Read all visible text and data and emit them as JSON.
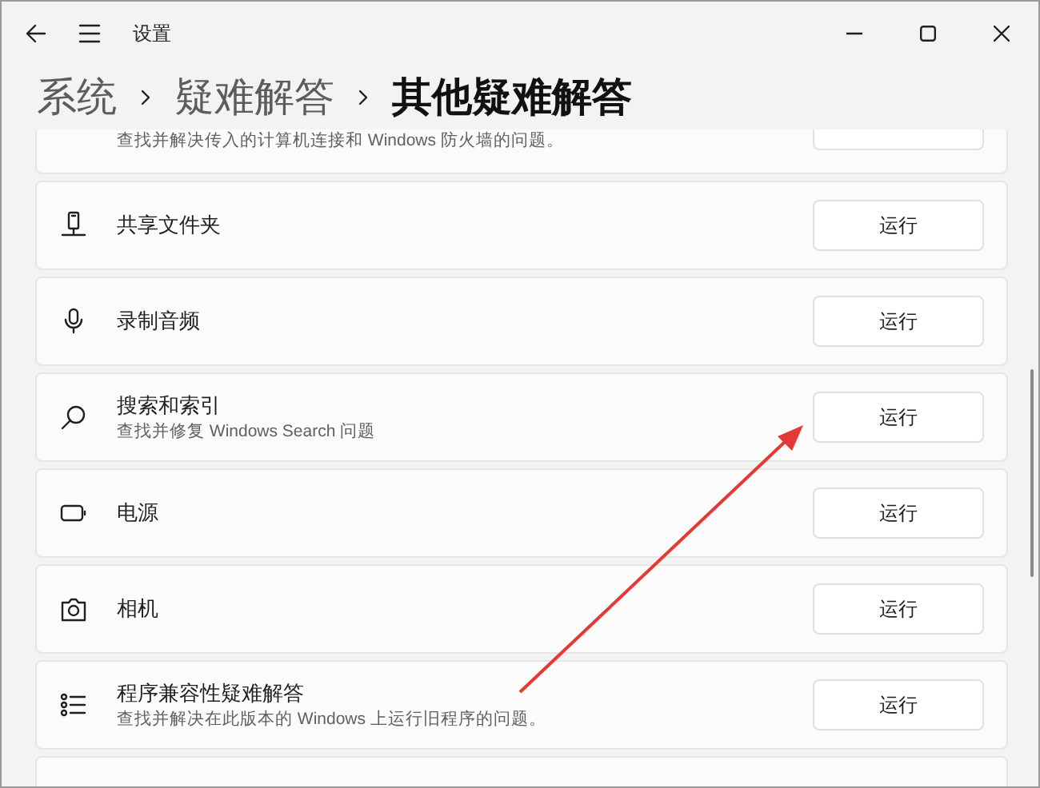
{
  "window": {
    "title": "设置"
  },
  "breadcrumb": [
    "系统",
    "疑难解答",
    "其他疑难解答"
  ],
  "items": [
    {
      "description": "查找并解决传入的计算机连接和 Windows 防火墙的问题。"
    },
    {
      "title": "共享文件夹",
      "button": "运行"
    },
    {
      "title": "录制音频",
      "button": "运行"
    },
    {
      "title": "搜索和索引",
      "description": "查找并修复 Windows Search 问题",
      "button": "运行"
    },
    {
      "title": "电源",
      "button": "运行"
    },
    {
      "title": "相机",
      "button": "运行"
    },
    {
      "title": "程序兼容性疑难解答",
      "description": "查找并解决在此版本的 Windows 上运行旧程序的问题。",
      "button": "运行"
    }
  ]
}
